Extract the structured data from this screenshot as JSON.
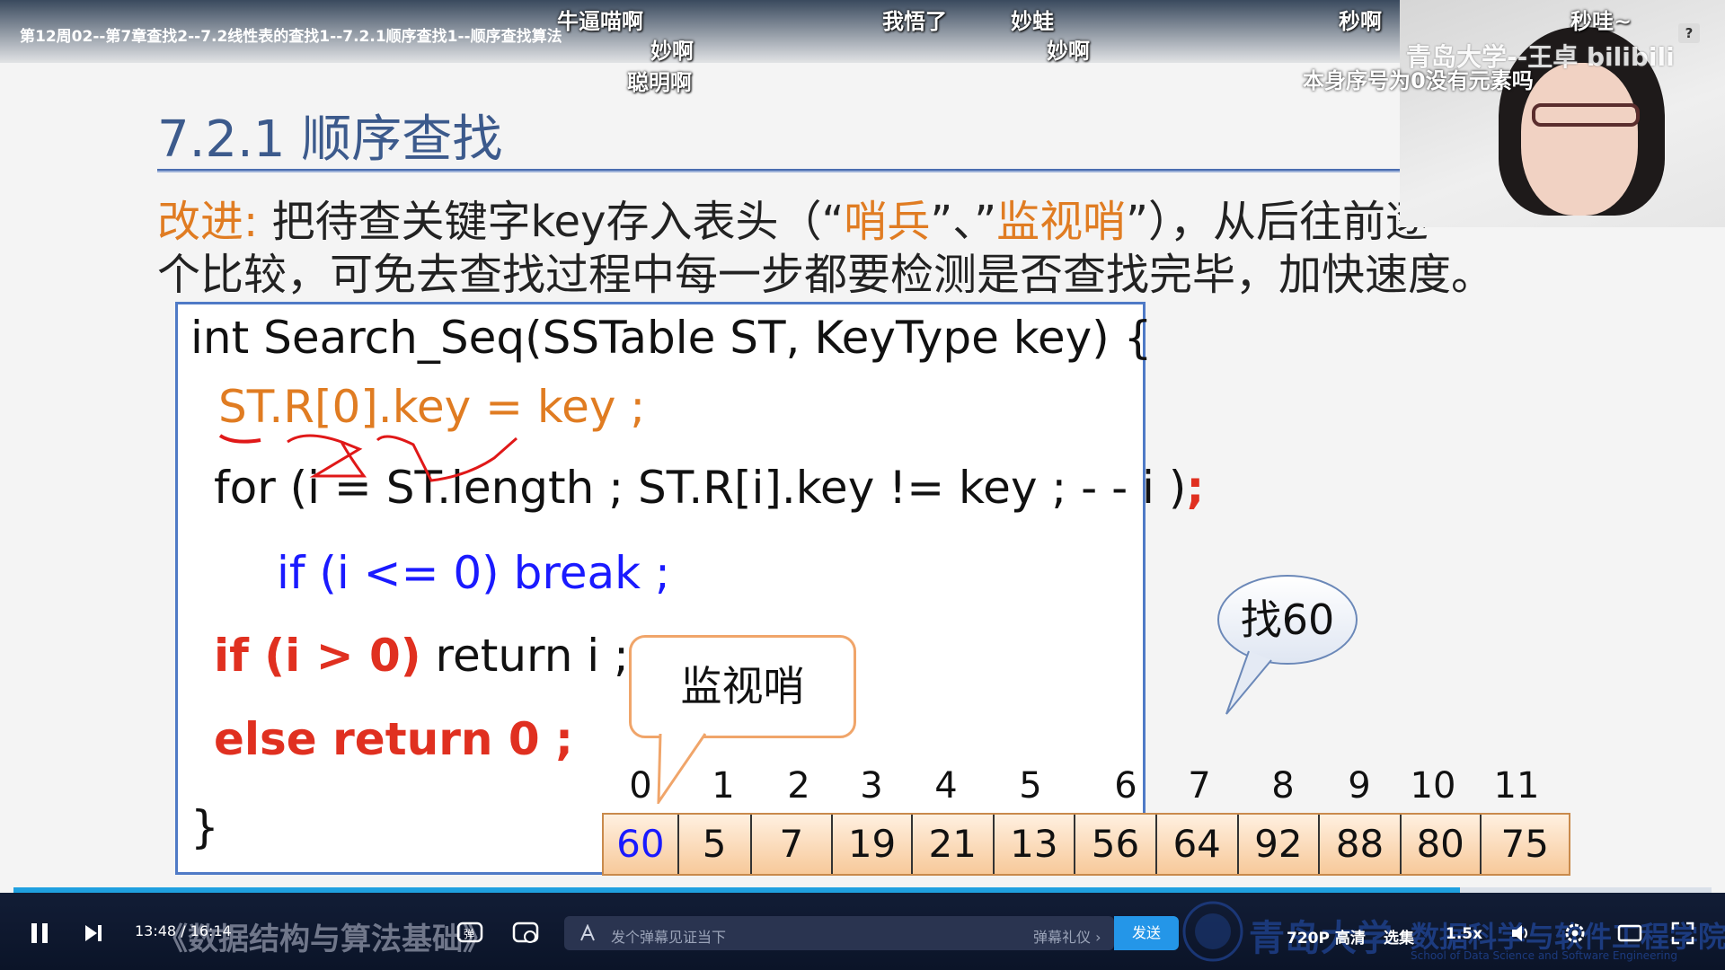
{
  "video": {
    "title": "第12周02--第7章查找2--7.2线性表的查找1--7.2.1顺序查找1--顺序查找算法",
    "help_label": "?"
  },
  "danmaku": [
    {
      "text": "牛逼喵啊"
    },
    {
      "text": "我悟了"
    },
    {
      "text": "妙蛙"
    },
    {
      "text": "秒啊"
    },
    {
      "text": "秒哇~"
    },
    {
      "text": "妙啊"
    },
    {
      "text": "妙啊"
    },
    {
      "text": "聪明啊"
    },
    {
      "text": "本身序号为0没有元素吗"
    }
  ],
  "camera": {
    "overlay_text": "青岛大学--王卓 bilibili"
  },
  "slide": {
    "section_title": "7.2.1 顺序查找",
    "line1_label": "改进:",
    "line1_a": "把待查关键字key存入表头（“",
    "line1_b": "哨兵",
    "line1_c": "”、”",
    "line1_d": "监视哨",
    "line1_e": "”），从后往前逐",
    "line2": "个比较，可免去查找过程中每一步都要检测是否查找完毕，加快速度。",
    "code": {
      "line1": "int Search_Seq(SSTable ST,  KeyType key) {",
      "line2": "ST.R[0].key = key ;",
      "line3": "for (i = ST.length ;  ST.R[i].key != key ;  - - i )",
      "line3_semi": ";",
      "line4": "if (i <= 0) break ;",
      "line5a": "if (i > 0)",
      "line5b": " return i ;",
      "line6": "else return 0 ;",
      "line7": "}"
    },
    "bubble_watch": "监视哨",
    "bubble_find": "找60",
    "array_indices": [
      "0",
      "1",
      "2",
      "3",
      "4",
      "5",
      "6",
      "7",
      "8",
      "9",
      "10",
      "11"
    ],
    "array_values": [
      "60",
      "5",
      "7",
      "19",
      "21",
      "13",
      "56",
      "64",
      "92",
      "88",
      "80",
      "75"
    ]
  },
  "controls": {
    "time_current": "13:48",
    "time_sep": "/",
    "time_total": "16:14",
    "danmaku_placeholder": "发个弹幕见证当下",
    "danmaku_etiquette": "弹幕礼仪 ›",
    "send_label": "发送",
    "quality_label": "720P 高清",
    "episodes_label": "选集",
    "speed_label": "1.5x",
    "course_watermark": "《数据结构与算法基础》",
    "university_logo": "青岛大学",
    "institute_cn": "数据科学与软件工程学院",
    "institute_en": "School of Data Science and Software Engineering"
  }
}
